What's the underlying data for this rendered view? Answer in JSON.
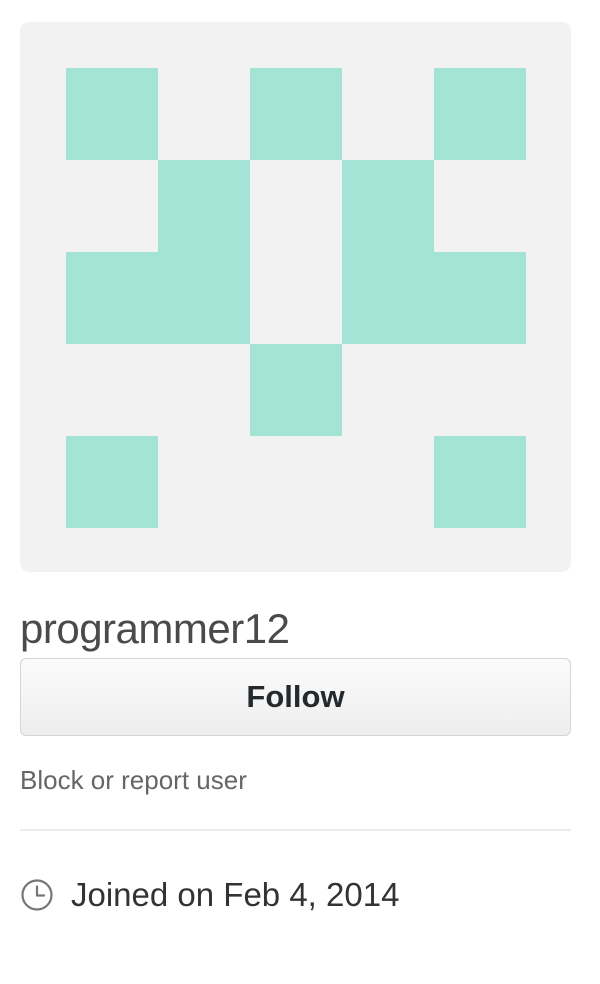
{
  "profile": {
    "username": "programmer12",
    "avatar": {
      "kind": "identicon",
      "background_color": "#f2f2f2",
      "fill_color": "#a3e4d7",
      "grid": [
        [
          1,
          0,
          1,
          0,
          1
        ],
        [
          0,
          1,
          0,
          1,
          0
        ],
        [
          1,
          1,
          0,
          1,
          1
        ],
        [
          0,
          0,
          1,
          0,
          0
        ],
        [
          1,
          0,
          0,
          0,
          1
        ]
      ]
    },
    "follow_label": "Follow",
    "block_report_label": "Block or report user",
    "joined_icon": "clock-icon",
    "joined_text": "Joined on Feb 4, 2014"
  }
}
